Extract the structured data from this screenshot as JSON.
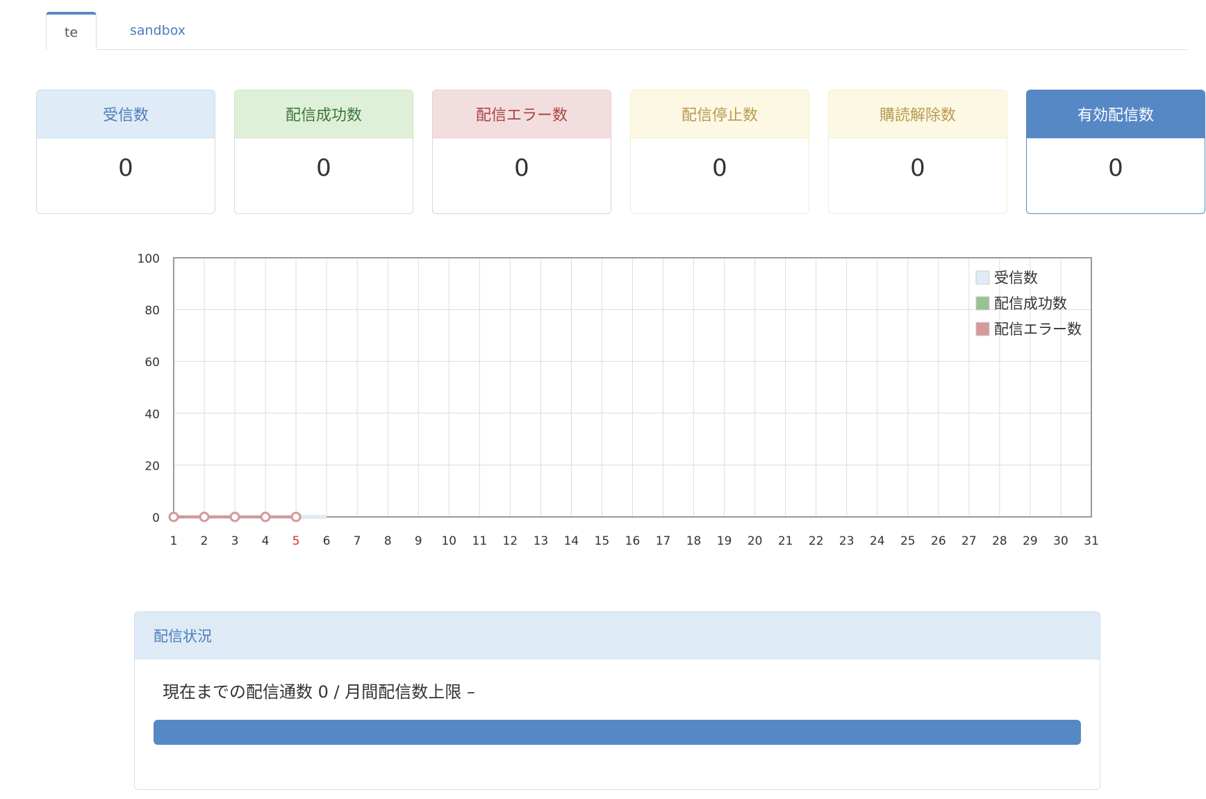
{
  "tabs": [
    {
      "label": "te",
      "active": true
    },
    {
      "label": "sandbox",
      "active": false
    }
  ],
  "stats": [
    {
      "label": "受信数",
      "value": "0",
      "head_bg": "#dfecf7",
      "head_color": "#4a7dba",
      "border": "#c7dcee"
    },
    {
      "label": "配信成功数",
      "value": "0",
      "head_bg": "#dff0d8",
      "head_color": "#3c763d",
      "border": "#d0e3c4"
    },
    {
      "label": "配信エラー数",
      "value": "0",
      "head_bg": "#f2dede",
      "head_color": "#a94442",
      "border": "#ebcccc"
    },
    {
      "label": "配信停止数",
      "value": "0",
      "head_bg": "#fcf8e3",
      "head_color": "#b89a50",
      "border": "#f3ecce"
    },
    {
      "label": "購読解除数",
      "value": "0",
      "head_bg": "#fcf8e3",
      "head_color": "#b89a50",
      "border": "#f3ecce"
    },
    {
      "label": "有効配信数",
      "value": "0",
      "head_bg": "#5788c6",
      "head_color": "#ffffff",
      "border": "#5788c6"
    }
  ],
  "chart_data": {
    "type": "line",
    "x": [
      1,
      2,
      3,
      4,
      5,
      6,
      7,
      8,
      9,
      10,
      11,
      12,
      13,
      14,
      15,
      16,
      17,
      18,
      19,
      20,
      21,
      22,
      23,
      24,
      25,
      26,
      27,
      28,
      29,
      30,
      31
    ],
    "highlight_x": 5,
    "highlight_color": "#e0321e",
    "ylim": [
      0,
      100
    ],
    "yticks": [
      0,
      20,
      40,
      60,
      80,
      100
    ],
    "grid": true,
    "legend_position": "top-right",
    "series": [
      {
        "name": "受信数",
        "color": "#dfecf7",
        "x": [
          1,
          2,
          3,
          4,
          5,
          6
        ],
        "values": [
          0,
          0,
          0,
          0,
          0,
          0
        ],
        "markers": false
      },
      {
        "name": "配信成功数",
        "color": "#99c294",
        "x": [
          1,
          2,
          3,
          4,
          5
        ],
        "values": [
          0,
          0,
          0,
          0,
          0
        ],
        "markers": false
      },
      {
        "name": "配信エラー数",
        "color": "#d49999",
        "x": [
          1,
          2,
          3,
          4,
          5
        ],
        "values": [
          0,
          0,
          0,
          0,
          0
        ],
        "markers": true
      }
    ]
  },
  "status_panel": {
    "title": "配信状況",
    "text": "現在までの配信通数 0 / 月間配信数上限 –",
    "progress_fill_percent": 100,
    "progress_color": "#5788c6"
  }
}
